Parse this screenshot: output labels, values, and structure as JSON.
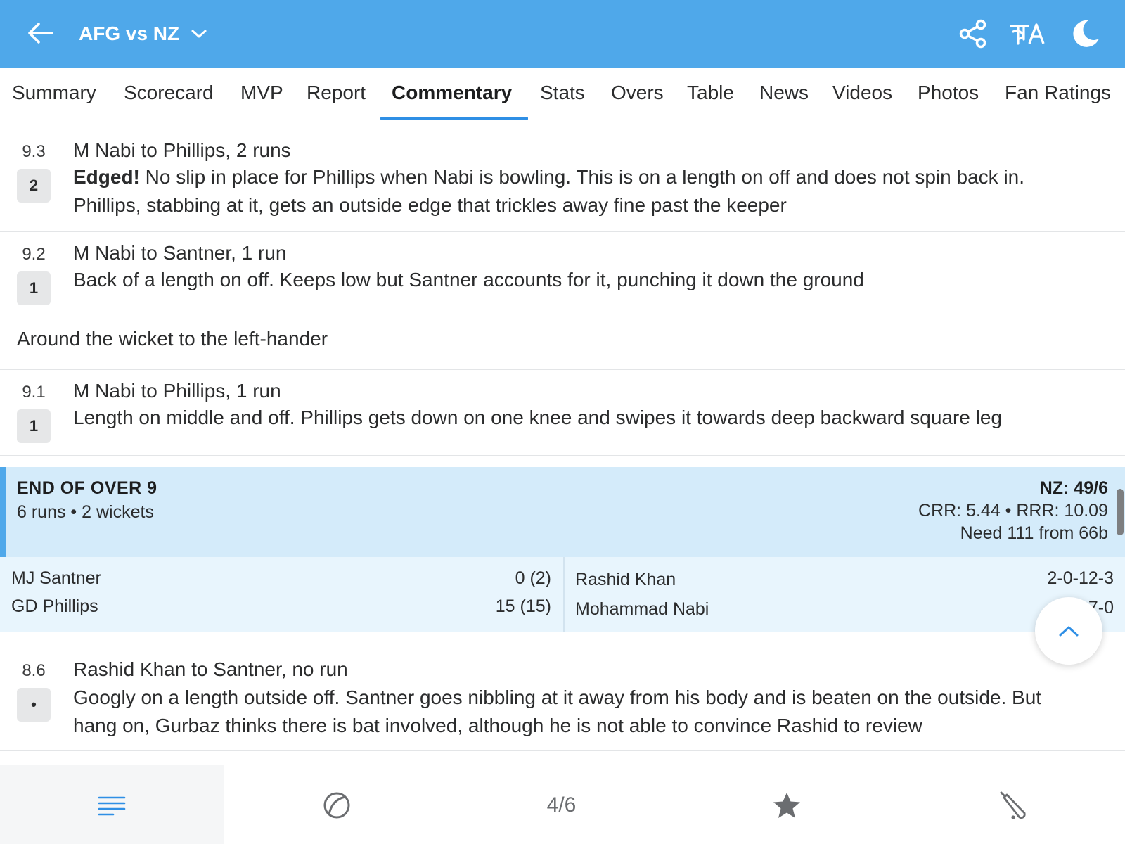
{
  "header": {
    "match_title": "AFG vs NZ",
    "lang_label": "क‌A"
  },
  "tabs": [
    {
      "label": "Summary"
    },
    {
      "label": "Scorecard"
    },
    {
      "label": "MVP"
    },
    {
      "label": "Report"
    },
    {
      "label": "Commentary",
      "active": true
    },
    {
      "label": "Stats"
    },
    {
      "label": "Overs"
    },
    {
      "label": "Table"
    },
    {
      "label": "News"
    },
    {
      "label": "Videos"
    },
    {
      "label": "Photos"
    },
    {
      "label": "Fan Ratings"
    }
  ],
  "commentary": [
    {
      "over": "9.3",
      "runs": "2",
      "title": "M Nabi to Phillips, 2 runs",
      "highlight": "Edged!",
      "text": " No slip in place for Phillips when Nabi is bowling. This is on a length on off and does not spin back in. Phillips, stabbing at it, gets an outside edge that trickles away fine past the keeper"
    },
    {
      "over": "9.2",
      "runs": "1",
      "title": "M Nabi to Santner, 1 run",
      "text": "Back of a length on off. Keeps low but Santner accounts for it, punching it down the ground"
    },
    {
      "over": "9.1",
      "runs": "1",
      "title": "M Nabi to Phillips, 1 run",
      "text": "Length on middle and off. Phillips gets down on one knee and swipes it towards deep backward square leg"
    },
    {
      "over": "8.6",
      "runs": "•",
      "title": "Rashid Khan to Santner, no run",
      "text": "Googly on a length outside off. Santner goes nibbling at it away from his body and is beaten on the outside. But hang on, Gurbaz thinks there is bat involved, although he is not able to convince Rashid to review"
    }
  ],
  "note": "Around the wicket to the left-hander",
  "end_of_over": {
    "title": "END OF OVER 9",
    "summary": "6 runs • 2 wickets",
    "score": "NZ: 49/6",
    "rates": "CRR: 5.44 • RRR: 10.09",
    "need": "Need 111 from 66b",
    "batters": [
      {
        "name": "MJ Santner",
        "score": "0 (2)"
      },
      {
        "name": "GD Phillips",
        "score": "15 (15)"
      }
    ],
    "bowlers": [
      {
        "name": "Rashid Khan",
        "figures": "2-0-12-3"
      },
      {
        "name": "Mohammad Nabi",
        "figures": "7-0"
      }
    ]
  },
  "bottom_nav": {
    "page_indicator": "4/6",
    "items": [
      "menu-icon",
      "ball-icon",
      "page-indicator",
      "star-icon",
      "bat-icon"
    ]
  },
  "colors": {
    "header_bg": "#4fa8ea",
    "tab_underline": "#2f8fe5",
    "eoo_bg": "#d4ebfa",
    "players_bg": "#e8f5fd",
    "accent_icon": "#2f8fe5"
  }
}
